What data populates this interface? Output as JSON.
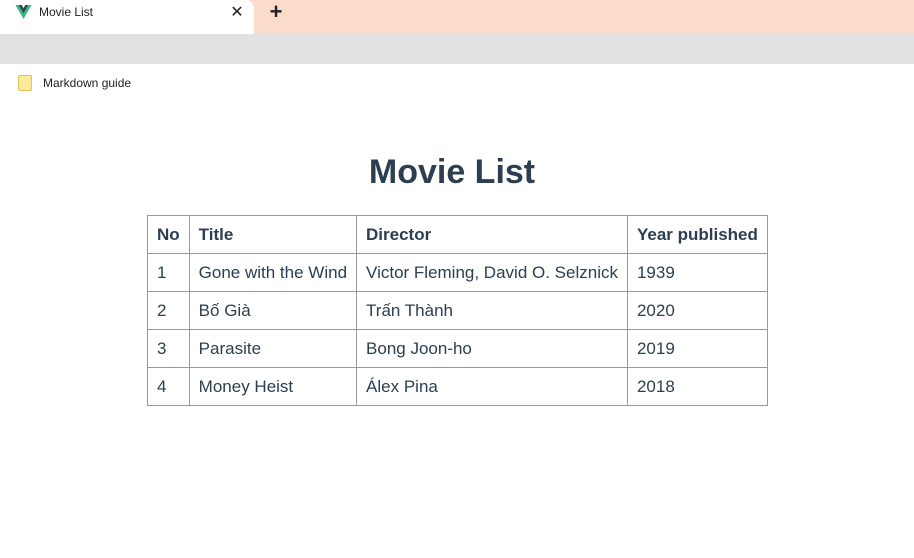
{
  "browser": {
    "tab": {
      "title": "Movie List",
      "favicon": "vue-logo-icon",
      "close_glyph": "✕"
    },
    "new_tab_glyph": "+",
    "bookmarks": [
      {
        "label": "Markdown guide",
        "icon": "folder-icon"
      }
    ]
  },
  "page": {
    "title": "Movie List",
    "table": {
      "headers": [
        "No",
        "Title",
        "Director",
        "Year published"
      ],
      "rows": [
        [
          "1",
          "Gone with the Wind",
          "Victor Fleming, David O. Selznick",
          "1939"
        ],
        [
          "2",
          "Bố Già",
          "Trấn Thành",
          "2020"
        ],
        [
          "3",
          "Parasite",
          "Bong Joon-ho",
          "2019"
        ],
        [
          "4",
          "Money Heist",
          "Álex Pina",
          "2018"
        ]
      ]
    }
  },
  "colors": {
    "tabstrip": "#fbdcca",
    "toolbar": "#e2e2e2",
    "heading_text": "#2c3e50",
    "table_border": "#999999",
    "vue_green": "#41b883",
    "vue_dark": "#35495e"
  }
}
